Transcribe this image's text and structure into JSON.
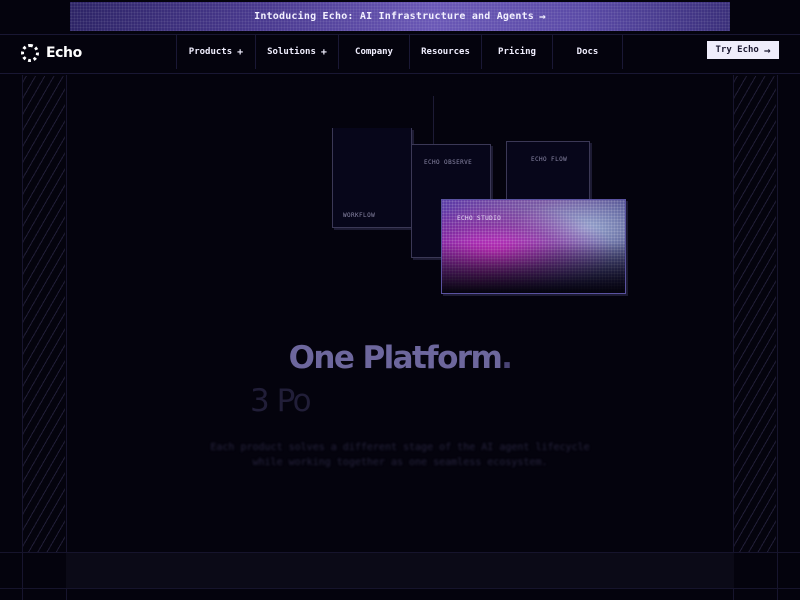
{
  "banner": {
    "text": "Intoducing Echo: AI Infrastructure and Agents",
    "arrow": "→"
  },
  "brand": {
    "name": "Echo",
    "logo_icon": "dotted-circle-icon"
  },
  "nav": {
    "items": [
      {
        "label": "Products",
        "suffix": "+"
      },
      {
        "label": "Solutions",
        "suffix": "+"
      },
      {
        "label": "Company",
        "suffix": ""
      },
      {
        "label": "Resources",
        "suffix": ""
      },
      {
        "label": "Pricing",
        "suffix": ""
      },
      {
        "label": "Docs",
        "suffix": ""
      }
    ],
    "cta": {
      "label": "Try Echo",
      "arrow": "→"
    }
  },
  "illustration": {
    "cards": {
      "workflow": "WORKFLOW",
      "observe": "ECHO OBSERVE",
      "flow": "ECHO FLOW",
      "studio": "ECHO STUDIO"
    }
  },
  "hero": {
    "title": "One Platform",
    "title_dot": ".",
    "subtitle": "3 Po",
    "description_line1": "Each product solves a different stage of the AI agent lifecycle",
    "description_line2": "while working together as one seamless ecosystem."
  },
  "colors": {
    "background": "#04030d",
    "accent": "#6a58b6",
    "hero_title": "#6d679d"
  }
}
